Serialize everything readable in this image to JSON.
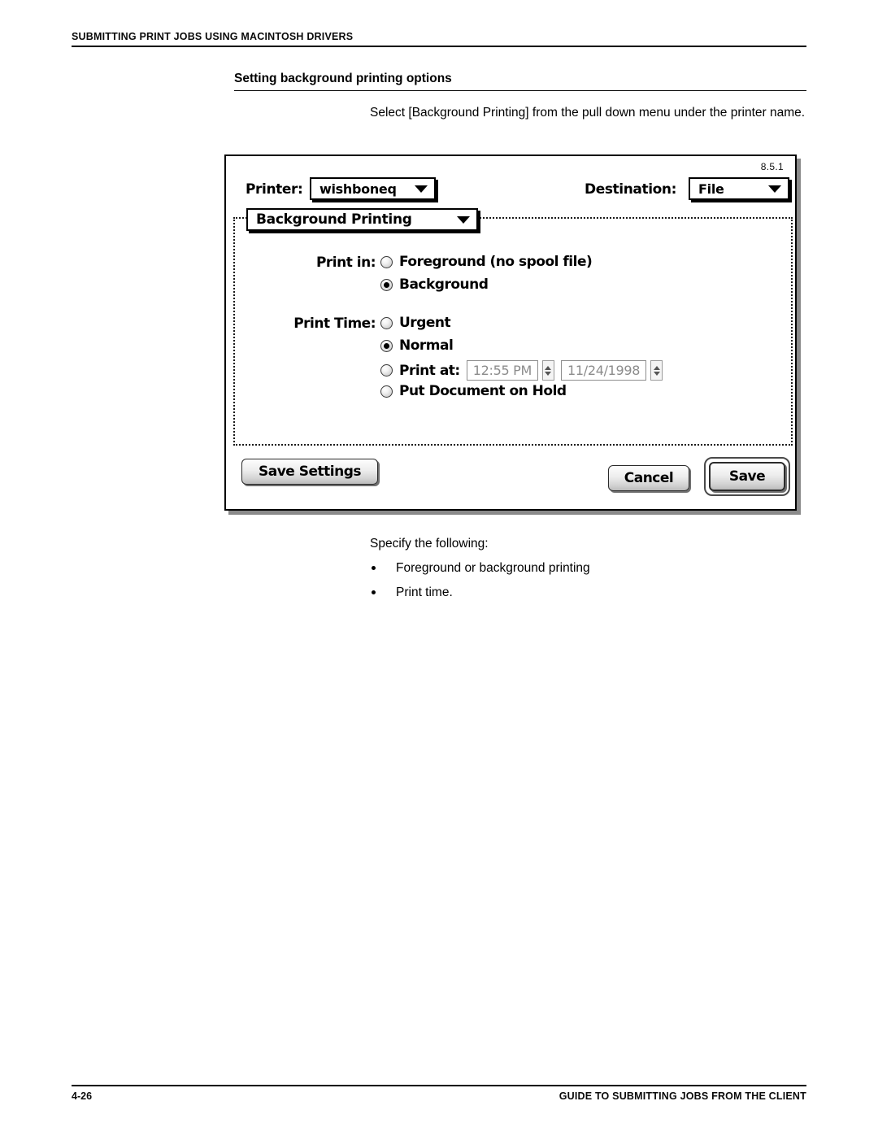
{
  "page": {
    "running_head": "SUBMITTING PRINT JOBS USING MACINTOSH DRIVERS",
    "section_heading": "Setting background printing options",
    "intro_paragraph": "Select [Background Printing] from the pull down menu under the printer name.",
    "footer_page_number": "4-26",
    "footer_title": "GUIDE TO SUBMITTING JOBS FROM THE CLIENT"
  },
  "dialog": {
    "version": "8.5.1",
    "printer_label": "Printer:",
    "printer_value": "wishboneq",
    "destination_label": "Destination:",
    "destination_value": "File",
    "pane_value": "Background Printing",
    "print_in_label": "Print in:",
    "print_time_label": "Print Time:",
    "options": {
      "foreground": "Foreground (no spool file)",
      "background": "Background",
      "urgent": "Urgent",
      "normal": "Normal",
      "print_at": "Print at:",
      "hold": "Put Document on Hold"
    },
    "print_at_time": "12:55 PM",
    "print_at_date": "11/24/1998",
    "buttons": {
      "save_settings": "Save Settings",
      "cancel": "Cancel",
      "save": "Save"
    }
  },
  "body": {
    "lead": "Specify the following:",
    "bullets": [
      "Foreground or background printing",
      "Print time."
    ]
  }
}
